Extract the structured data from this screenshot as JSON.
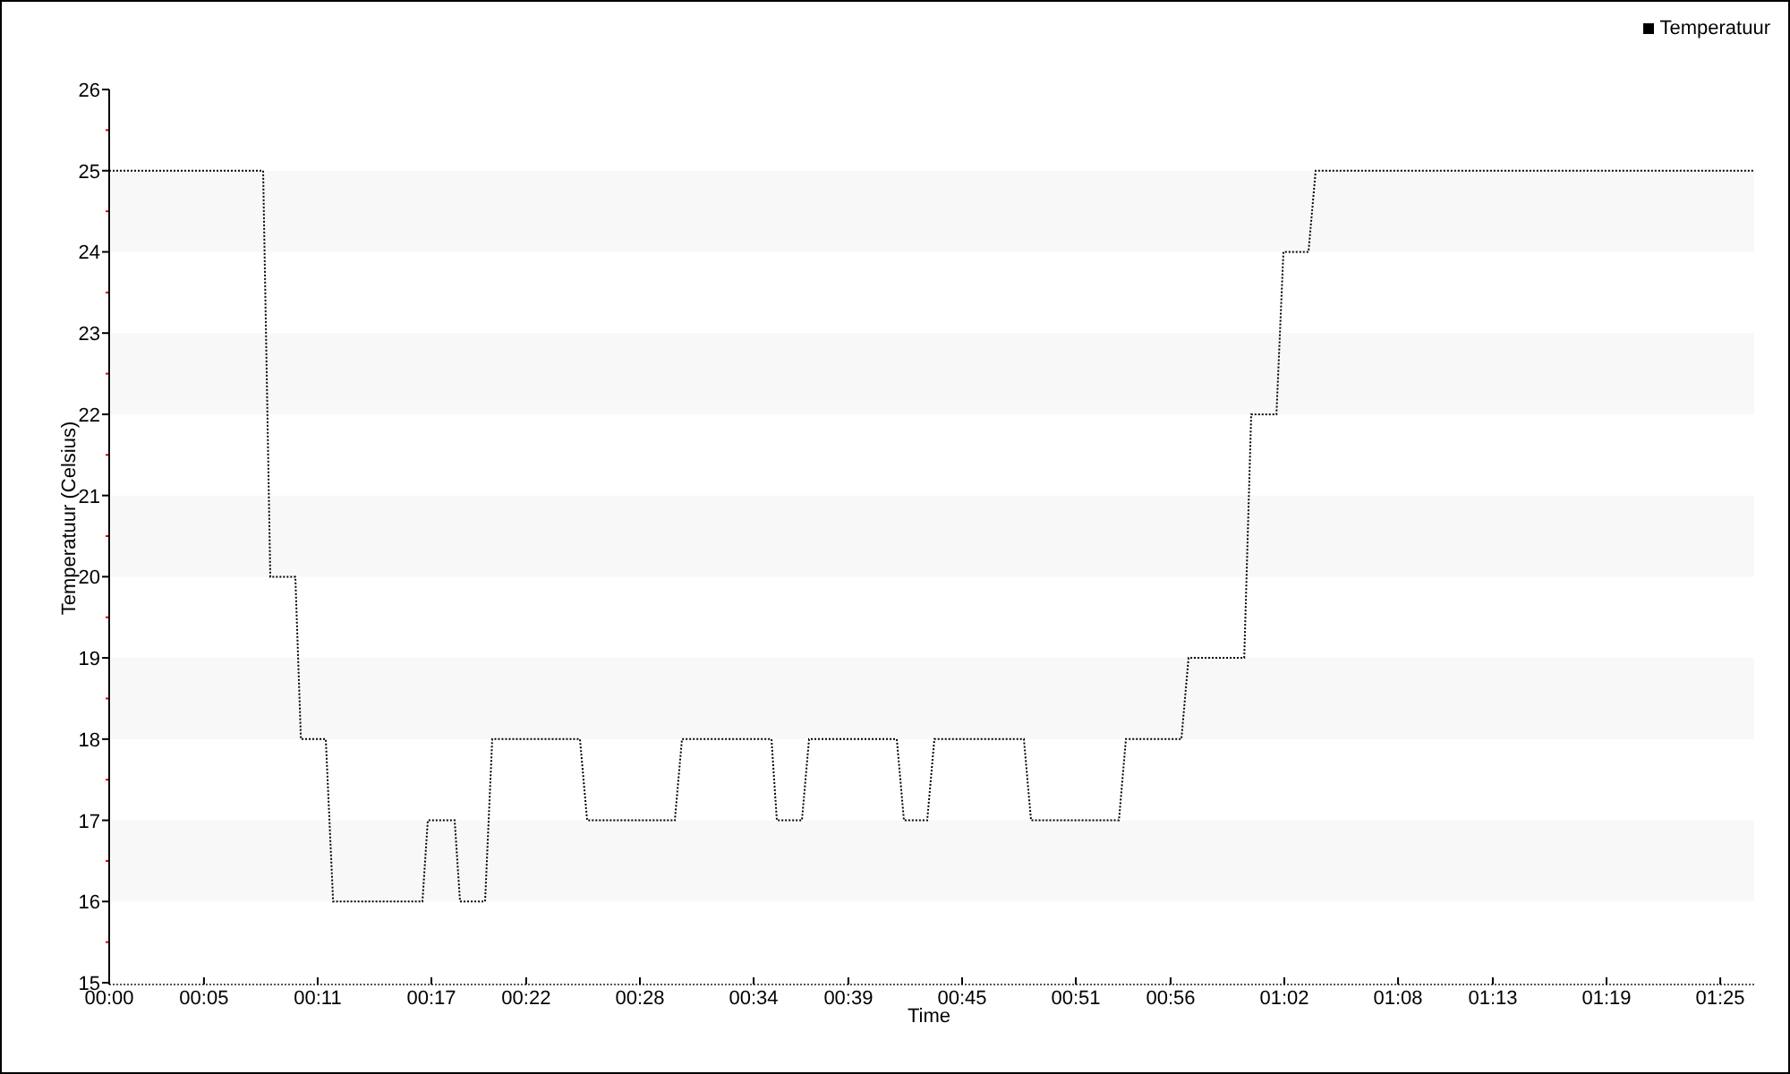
{
  "chart_data": {
    "type": "line",
    "xlabel": "Time",
    "ylabel": "Temperatuur (Celsius)",
    "x": [
      0,
      8.12,
      8.5,
      9.82,
      10.11,
      11.43,
      11.81,
      16.53,
      16.81,
      18.23,
      18.51,
      19.83,
      20.21,
      24.84,
      25.22,
      29.84,
      30.22,
      34.94,
      35.23,
      36.55,
      36.93,
      41.55,
      41.93,
      43.16,
      43.54,
      48.26,
      48.64,
      53.27,
      53.64,
      56.57,
      56.95,
      59.88,
      60.25,
      61.58,
      61.95,
      63.27,
      63.65,
      86.79
    ],
    "series": [
      {
        "name": "Temperatuur",
        "color": "#000000",
        "line_style": "dotted",
        "values": [
          25,
          25,
          20,
          20,
          18,
          18,
          16,
          16,
          17,
          17,
          16,
          16,
          18,
          18,
          17,
          17,
          18,
          18,
          17,
          17,
          18,
          18,
          17,
          17,
          18,
          18,
          17,
          17,
          18,
          18,
          19,
          19,
          22,
          22,
          24,
          24,
          25,
          25
        ]
      }
    ],
    "xlim": [
      0,
      86.79
    ],
    "ylim": [
      15,
      26
    ],
    "xticks": [
      {
        "value": 0,
        "label": "00:00"
      },
      {
        "value": 5,
        "label": "00:05"
      },
      {
        "value": 11,
        "label": "00:11"
      },
      {
        "value": 17,
        "label": "00:17"
      },
      {
        "value": 22,
        "label": "00:22"
      },
      {
        "value": 28,
        "label": "00:28"
      },
      {
        "value": 34,
        "label": "00:34"
      },
      {
        "value": 39,
        "label": "00:39"
      },
      {
        "value": 45,
        "label": "00:45"
      },
      {
        "value": 51,
        "label": "00:51"
      },
      {
        "value": 56,
        "label": "00:56"
      },
      {
        "value": 62,
        "label": "01:02"
      },
      {
        "value": 68,
        "label": "01:08"
      },
      {
        "value": 73,
        "label": "01:13"
      },
      {
        "value": 79,
        "label": "01:19"
      },
      {
        "value": 85,
        "label": "01:25"
      }
    ],
    "yticks": [
      15,
      16,
      17,
      18,
      19,
      20,
      21,
      22,
      23,
      24,
      25,
      26
    ]
  }
}
